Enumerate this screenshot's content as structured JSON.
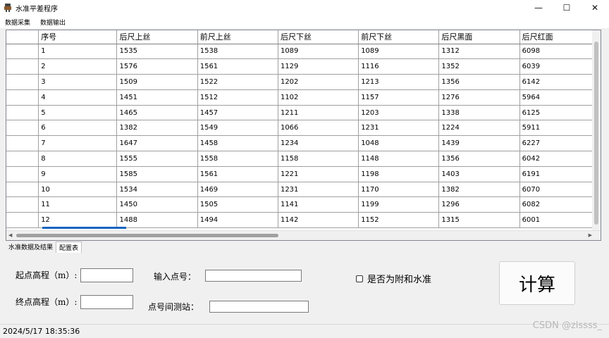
{
  "window": {
    "title": "水准平差程序",
    "minimize": "—",
    "maximize": "☐",
    "close": "✕"
  },
  "menu": [
    "数据采集",
    "数据输出"
  ],
  "grid": {
    "headers": [
      "序号",
      "后尺上丝",
      "前尺上丝",
      "后尺下丝",
      "前尺下丝",
      "后尺黑面",
      "后尺红面"
    ],
    "rows": [
      [
        "1",
        "1535",
        "1538",
        "1089",
        "1089",
        "1312",
        "6098"
      ],
      [
        "2",
        "1576",
        "1561",
        "1129",
        "1116",
        "1352",
        "6039"
      ],
      [
        "3",
        "1509",
        "1522",
        "1202",
        "1213",
        "1356",
        "6142"
      ],
      [
        "4",
        "1451",
        "1512",
        "1102",
        "1157",
        "1276",
        "5964"
      ],
      [
        "5",
        "1465",
        "1457",
        "1211",
        "1203",
        "1338",
        "6125"
      ],
      [
        "6",
        "1382",
        "1549",
        "1066",
        "1231",
        "1224",
        "5911"
      ],
      [
        "7",
        "1647",
        "1458",
        "1234",
        "1048",
        "1439",
        "6227"
      ],
      [
        "8",
        "1555",
        "1558",
        "1158",
        "1148",
        "1356",
        "6042"
      ],
      [
        "9",
        "1585",
        "1561",
        "1221",
        "1198",
        "1403",
        "6191"
      ],
      [
        "10",
        "1534",
        "1469",
        "1231",
        "1170",
        "1382",
        "6070"
      ],
      [
        "11",
        "1450",
        "1505",
        "1141",
        "1199",
        "1296",
        "6082"
      ],
      [
        "12",
        "1488",
        "1494",
        "1142",
        "1152",
        "1315",
        "6001"
      ]
    ]
  },
  "tabs": [
    "水准数据及结果",
    "配置表"
  ],
  "form": {
    "start_elev_label": "起点高程（m）:",
    "end_elev_label": "终点高程（m）:",
    "point_no_label": "输入点号：",
    "station_label": "点号间测站：",
    "attach_checkbox_label": "是否为附和水准",
    "calc_button": "计算"
  },
  "status": {
    "datetime": "2024/5/17 18:35:36"
  },
  "watermark": "CSDN @zlssss_",
  "colors": {
    "selection": "#1565c0",
    "window_bg": "#f0f0f0"
  }
}
